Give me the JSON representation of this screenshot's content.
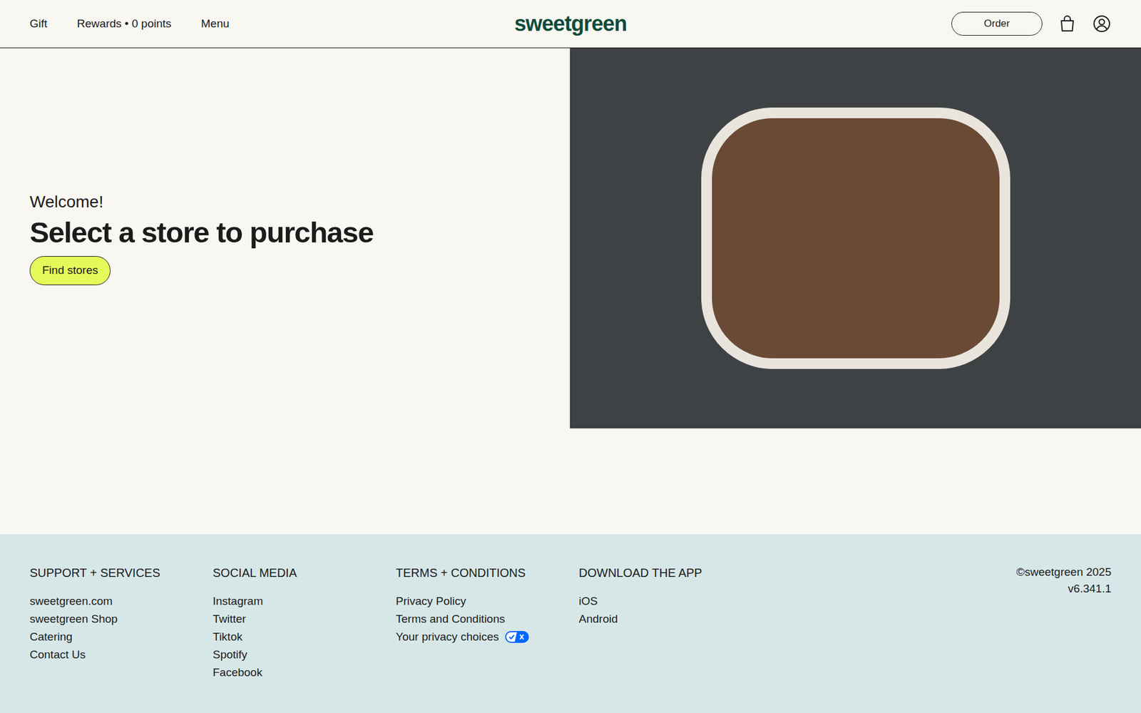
{
  "header": {
    "nav": [
      "Gift",
      "Rewards • 0 points",
      "Menu"
    ],
    "logo": "sweetgreen",
    "order_button": "Order"
  },
  "hero": {
    "welcome": "Welcome!",
    "heading": "Select a store to purchase",
    "button": "Find stores"
  },
  "footer": {
    "columns": [
      {
        "title": "SUPPORT + SERVICES",
        "links": [
          "sweetgreen.com",
          "sweetgreen Shop",
          "Catering",
          "Contact Us"
        ]
      },
      {
        "title": "SOCIAL MEDIA",
        "links": [
          "Instagram",
          "Twitter",
          "Tiktok",
          "Spotify",
          "Facebook"
        ]
      },
      {
        "title": "TERMS + CONDITIONS",
        "links": [
          "Privacy Policy",
          "Terms and Conditions",
          "Your privacy choices"
        ]
      },
      {
        "title": "DOWNLOAD THE APP",
        "links": [
          "iOS",
          "Android"
        ]
      }
    ],
    "copyright": "©sweetgreen 2025",
    "version": "v6.341.1"
  }
}
